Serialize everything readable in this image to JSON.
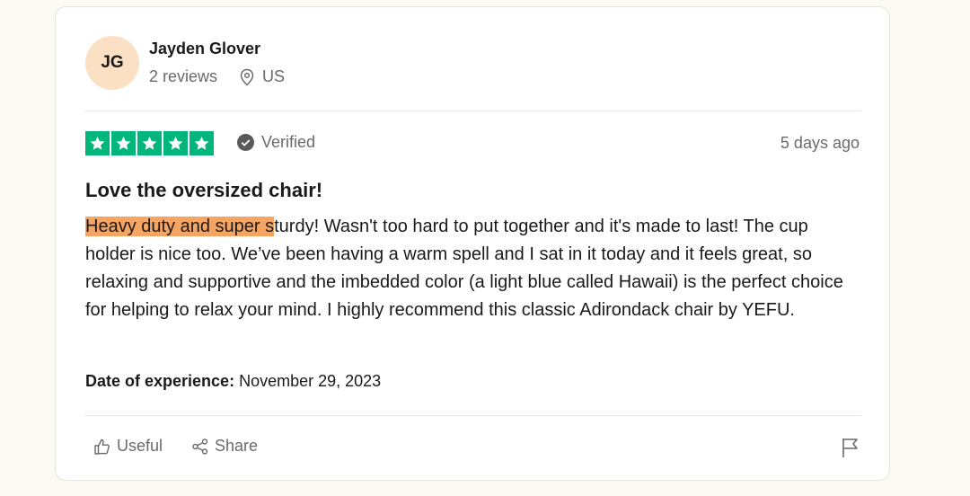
{
  "reviewer": {
    "initials": "JG",
    "name": "Jayden Glover",
    "reviews": "2 reviews",
    "country": "US"
  },
  "rating": {
    "stars": 5,
    "max": 5,
    "star_color": "#00b67a",
    "icon": "star-icon"
  },
  "verified_label": "Verified",
  "date_posted": "5 days ago",
  "review": {
    "title": "Love the oversized chair!",
    "highlighted_text": "Heavy duty and super s",
    "body_rest": "turdy! Wasn't too hard to put together and it's made to last! The cup holder is nice too. We’ve been having a warm spell and I sat in it today and it feels great, so relaxing and supportive and the imbedded color (a light blue called Hawaii) is the perfect choice for helping to relax your mind. I highly recommend this classic Adirondack chair by YEFU.",
    "highlight_color": "#f5a462"
  },
  "experience": {
    "label": "Date of experience:",
    "date": "November 29, 2023"
  },
  "actions": {
    "useful_label": "Useful",
    "share_label": "Share"
  },
  "icons": {
    "location": "location-pin-icon",
    "verified": "check-circle-icon",
    "useful": "thumbs-up-icon",
    "share": "share-icon",
    "flag": "flag-icon"
  }
}
